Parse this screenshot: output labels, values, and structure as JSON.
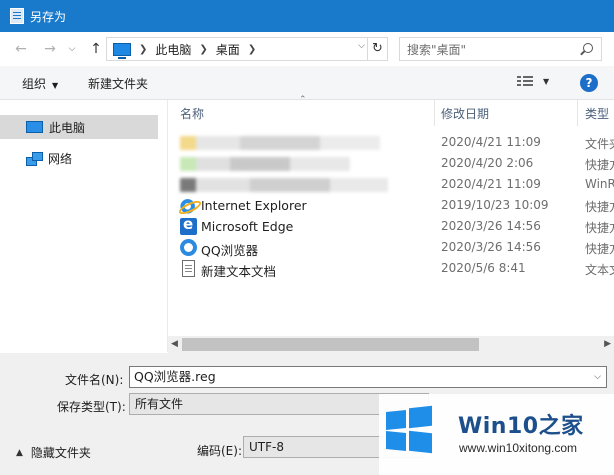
{
  "window": {
    "title": "另存为"
  },
  "address": {
    "back_icon": "arrow-left-icon",
    "forward_icon": "arrow-right-icon",
    "up_icon": "arrow-up-icon",
    "crumbs": [
      "此电脑",
      "桌面"
    ],
    "search_placeholder": "搜索\"桌面\""
  },
  "toolbar": {
    "organize": "组织",
    "new_folder": "新建文件夹"
  },
  "nav": {
    "items": [
      {
        "label": "此电脑",
        "selected": true
      },
      {
        "label": "网络",
        "selected": false
      }
    ]
  },
  "columns": {
    "name": "名称",
    "date": "修改日期",
    "type": "类型"
  },
  "files": [
    {
      "name": "",
      "date": "2020/4/21 11:09",
      "type": "文件夹",
      "icon": "folder-icon",
      "obscured": true
    },
    {
      "name": "",
      "date": "2020/4/20 2:06",
      "type": "快捷方式",
      "icon": "shortcut-icon",
      "obscured": true
    },
    {
      "name": "",
      "date": "2020/4/21 11:09",
      "type": "WinRAR",
      "icon": "archive-icon",
      "obscured": true
    },
    {
      "name": "Internet Explorer",
      "date": "2019/10/23 10:09",
      "type": "快捷方式",
      "icon": "internet-explorer-icon"
    },
    {
      "name": "Microsoft Edge",
      "date": "2020/3/26 14:56",
      "type": "快捷方式",
      "icon": "edge-icon"
    },
    {
      "name": "QQ浏览器",
      "date": "2020/3/26 14:56",
      "type": "快捷方式",
      "icon": "qq-browser-icon"
    },
    {
      "name": "新建文本文档",
      "date": "2020/5/6 8:41",
      "type": "文本文档",
      "icon": "text-document-icon"
    }
  ],
  "form": {
    "filename_label": "文件名(N):",
    "filename_value": "QQ浏览器.reg",
    "savetype_label": "保存类型(T):",
    "savetype_value": "所有文件",
    "encoding_label": "编码(E):",
    "encoding_value": "UTF-8",
    "hide_folders": "隐藏文件夹"
  },
  "watermark": {
    "title": "Win10之家",
    "url": "www.win10xitong.com"
  }
}
